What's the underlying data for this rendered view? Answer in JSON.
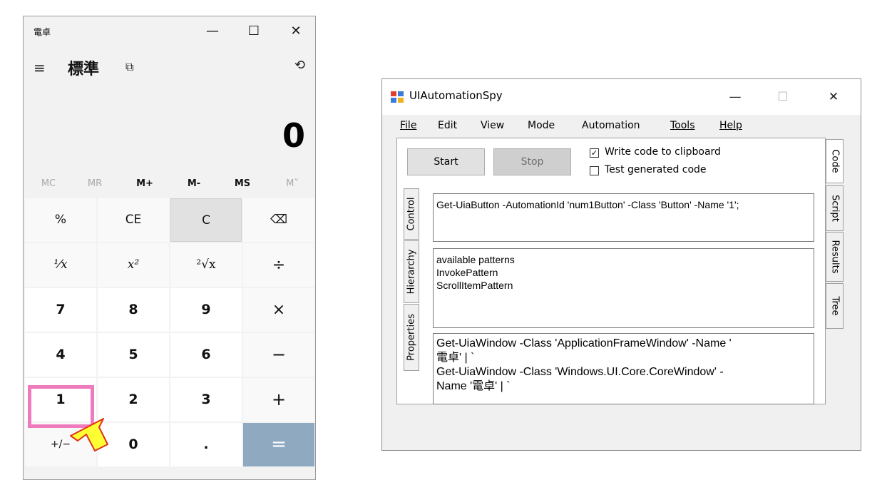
{
  "calculator": {
    "title": "電卓",
    "minimize": "—",
    "maximize": "☐",
    "close": "✕",
    "menu_icon": "≡",
    "mode": "標準",
    "keep_on_top_icon": "⧉",
    "history_icon": "⟲",
    "display": "0",
    "memory": [
      "MC",
      "MR",
      "M+",
      "M-",
      "MS",
      "M˅"
    ],
    "keys": [
      [
        "%",
        "CE",
        "C",
        "⌫"
      ],
      [
        "⅟x",
        "x²",
        "²√x",
        "÷"
      ],
      [
        "7",
        "8",
        "9",
        "×"
      ],
      [
        "4",
        "5",
        "6",
        "−"
      ],
      [
        "1",
        "2",
        "3",
        "+"
      ],
      [
        "+/−",
        "0",
        ".",
        "="
      ]
    ]
  },
  "spy": {
    "title": "UIAutomationSpy",
    "minimize": "—",
    "maximize": "☐",
    "close": "✕",
    "menu": [
      "File",
      "Edit",
      "View",
      "Mode",
      "Automation",
      "Tools",
      "Help"
    ],
    "start": "Start",
    "stop": "Stop",
    "write_clipboard": "Write code to clipboard",
    "test_code": "Test generated code",
    "left_tabs": [
      "Control",
      "Hierarchy",
      "Properties"
    ],
    "right_tabs": [
      "Code",
      "Script",
      "Results",
      "Tree"
    ],
    "code_text": "Get-UiaButton -AutomationId 'num1Button' -Class 'Button' -Name '1';",
    "patterns": [
      "available patterns",
      "InvokePattern",
      "ScrollItemPattern"
    ],
    "hierarchy_lines": [
      "Get-UiaWindow -Class 'ApplicationFrameWindow' -Name '",
      "電卓' | `",
      "Get-UiaWindow -Class 'Windows.UI.Core.CoreWindow' -",
      "Name '電卓' | `"
    ]
  }
}
